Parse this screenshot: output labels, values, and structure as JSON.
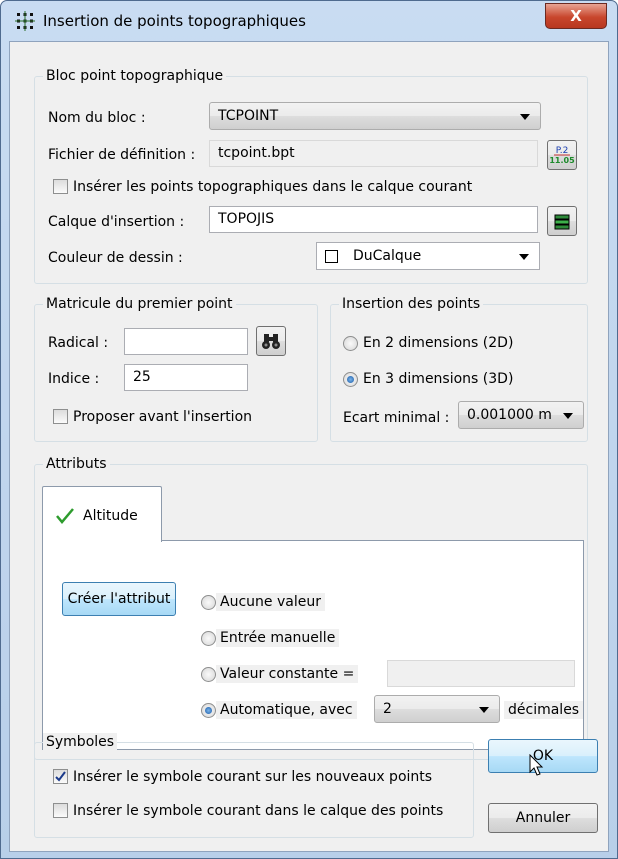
{
  "window": {
    "title": "Insertion de points topographiques",
    "close_glyph": "X"
  },
  "bloc": {
    "title": "Bloc point topographique",
    "nom_label": "Nom du bloc :",
    "nom_value": "TCPOINT",
    "fichier_label": "Fichier de définition :",
    "fichier_value": "tcpoint.bpt",
    "fichier_icon_top": "P.2",
    "fichier_icon_bottom": "11.05",
    "inserer_calque_label": "Insérer les points topographiques dans le calque courant",
    "inserer_calque_checked": false,
    "calque_label": "Calque d'insertion :",
    "calque_value": "TOPOJIS",
    "couleur_label": "Couleur de dessin :",
    "couleur_value": "DuCalque"
  },
  "matricule": {
    "title": "Matricule du premier point",
    "radical_label": "Radical :",
    "radical_value": "",
    "indice_label": "Indice :",
    "indice_value": "25",
    "proposer_label": "Proposer avant l'insertion",
    "proposer_checked": false
  },
  "insertion": {
    "title": "Insertion des points",
    "opt_2d": "En 2 dimensions (2D)",
    "opt_3d": "En 3 dimensions (3D)",
    "selected": "3D",
    "ecart_label": "Ecart minimal :",
    "ecart_value": "0.001000 m"
  },
  "attributs": {
    "title": "Attributs",
    "tab_label": "Altitude",
    "creer_label": "Créer l'attribut",
    "opt_aucune": "Aucune valeur",
    "opt_manuelle": "Entrée manuelle",
    "opt_constante": "Valeur constante =",
    "constante_value": "",
    "opt_auto": "Automatique, avec",
    "selected": "auto",
    "decimales_value": "2",
    "decimales_label": "décimales"
  },
  "symboles": {
    "title": "Symboles",
    "nouveaux_label": "Insérer le symbole courant sur les nouveaux points",
    "nouveaux_checked": true,
    "calque_label": "Insérer le symbole courant dans le calque des points",
    "calque_checked": false
  },
  "buttons": {
    "ok_label": "OK",
    "annuler_label": "Annuler"
  },
  "colors": {
    "accent": "#3c7fb1",
    "close": "#c8462d",
    "check_green": "#2e9c2e"
  }
}
